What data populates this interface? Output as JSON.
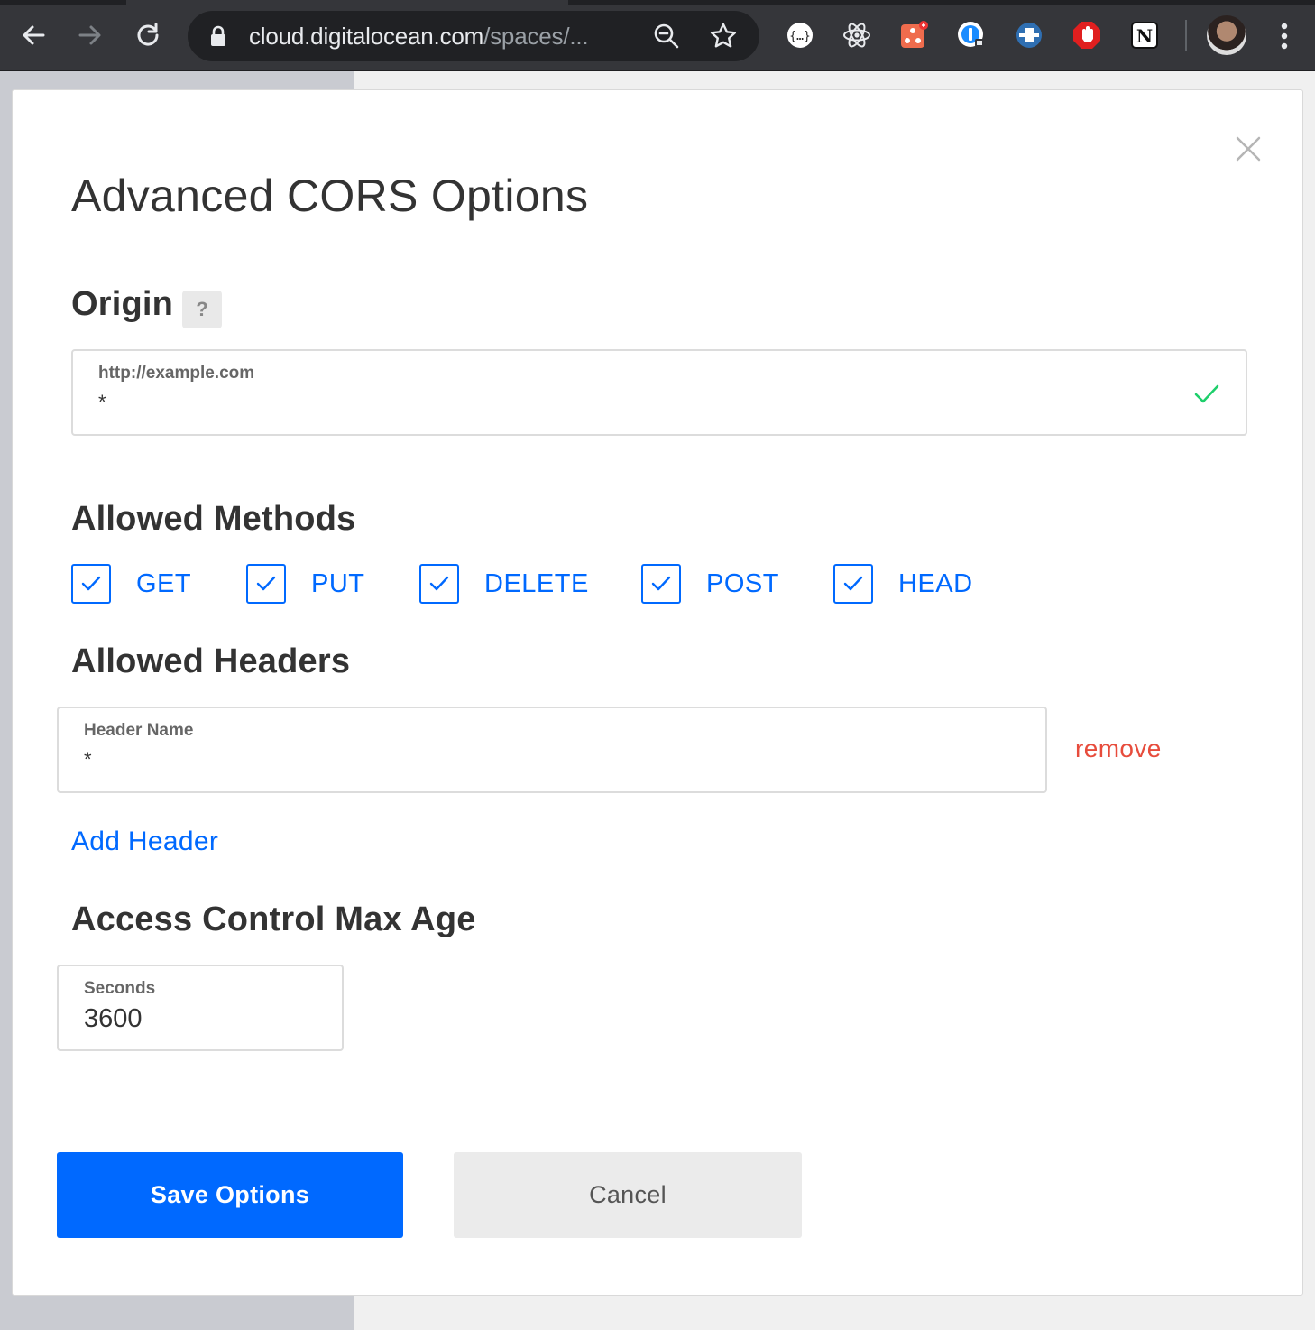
{
  "browser": {
    "url_host": "cloud.digitalocean.com",
    "url_path": "/spaces/...",
    "icons": [
      "back-icon",
      "forward-icon",
      "reload-icon",
      "lock-icon",
      "zoom-icon",
      "bookmark-star-icon",
      "more-menu-icon"
    ],
    "extensions": [
      "json-formatter-extension-icon",
      "react-devtools-extension-icon",
      "redux-devtools-extension-icon",
      "onepassword-extension-icon",
      "extension-icon",
      "adblock-extension-icon",
      "notion-extension-icon"
    ]
  },
  "modal": {
    "title": "Advanced CORS Options",
    "origin": {
      "heading": "Origin",
      "help_label": "?",
      "field_label": "http://example.com",
      "value": "*",
      "valid_color": "#1ecf6b"
    },
    "methods": {
      "heading": "Allowed Methods",
      "items": [
        {
          "label": "GET",
          "checked": true
        },
        {
          "label": "PUT",
          "checked": true
        },
        {
          "label": "DELETE",
          "checked": true
        },
        {
          "label": "POST",
          "checked": true
        },
        {
          "label": "HEAD",
          "checked": true
        }
      ]
    },
    "headers": {
      "heading": "Allowed Headers",
      "field_label": "Header Name",
      "value": "*",
      "remove_label": "remove",
      "add_label": "Add Header"
    },
    "max_age": {
      "heading": "Access Control Max Age",
      "field_label": "Seconds",
      "value": "3600"
    },
    "save_label": "Save Options",
    "cancel_label": "Cancel"
  },
  "colors": {
    "primary": "#0069ff",
    "danger": "#e74c3c",
    "heading": "#333333"
  }
}
